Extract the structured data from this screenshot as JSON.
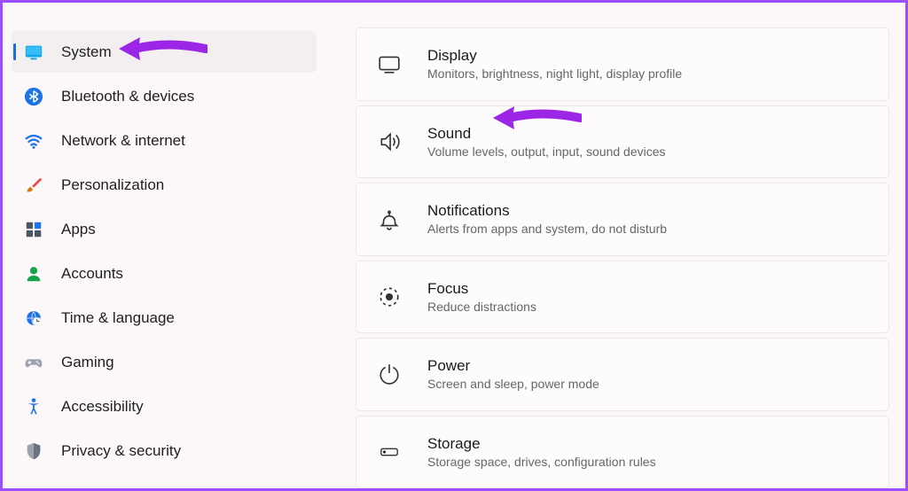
{
  "sidebar": {
    "items": [
      {
        "id": "system",
        "label": "System",
        "selected": true
      },
      {
        "id": "bluetooth",
        "label": "Bluetooth & devices",
        "selected": false
      },
      {
        "id": "network",
        "label": "Network & internet",
        "selected": false
      },
      {
        "id": "personalization",
        "label": "Personalization",
        "selected": false
      },
      {
        "id": "apps",
        "label": "Apps",
        "selected": false
      },
      {
        "id": "accounts",
        "label": "Accounts",
        "selected": false
      },
      {
        "id": "time",
        "label": "Time & language",
        "selected": false
      },
      {
        "id": "gaming",
        "label": "Gaming",
        "selected": false
      },
      {
        "id": "accessibility",
        "label": "Accessibility",
        "selected": false
      },
      {
        "id": "privacy",
        "label": "Privacy & security",
        "selected": false
      }
    ]
  },
  "cards": [
    {
      "id": "display",
      "title": "Display",
      "sub": "Monitors, brightness, night light, display profile"
    },
    {
      "id": "sound",
      "title": "Sound",
      "sub": "Volume levels, output, input, sound devices"
    },
    {
      "id": "notifications",
      "title": "Notifications",
      "sub": "Alerts from apps and system, do not disturb"
    },
    {
      "id": "focus",
      "title": "Focus",
      "sub": "Reduce distractions"
    },
    {
      "id": "power",
      "title": "Power",
      "sub": "Screen and sleep, power mode"
    },
    {
      "id": "storage",
      "title": "Storage",
      "sub": "Storage space, drives, configuration rules"
    }
  ],
  "annotations": {
    "arrow_color": "#9b26e6"
  }
}
